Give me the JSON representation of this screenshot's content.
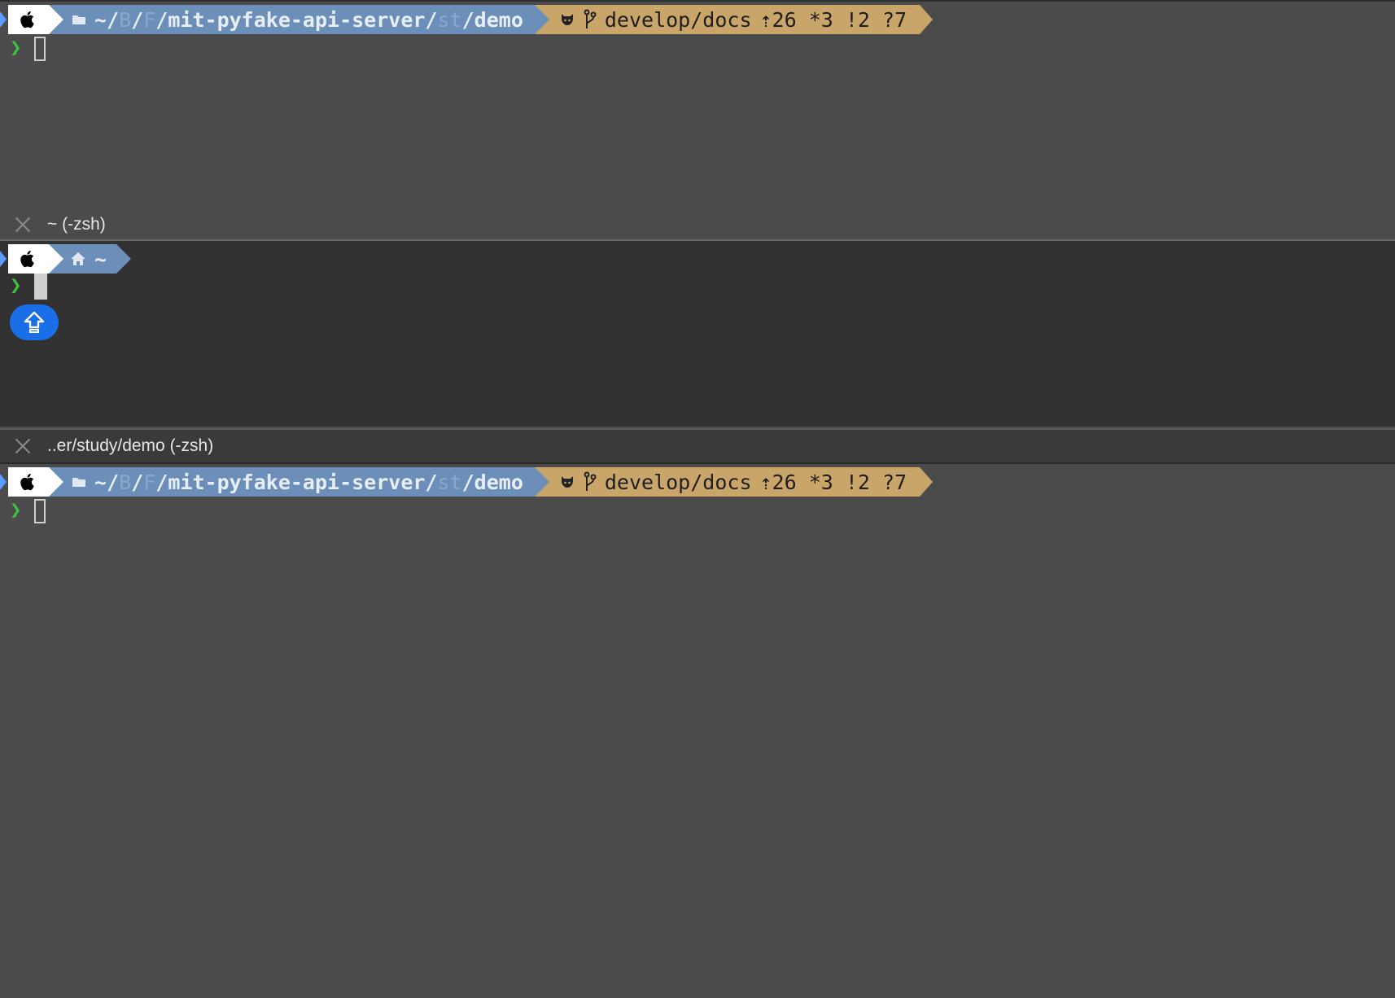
{
  "pane_top": {
    "prompt": {
      "path_home": "~/",
      "path_b": "B",
      "sep1": "/",
      "path_f": "F",
      "sep2": "/",
      "path_main": "mit-pyfake-api-server/",
      "path_st": "st",
      "path_end": "/demo",
      "git_branch": "develop/docs",
      "git_status": "⇡26 *3 !2 ?7"
    }
  },
  "divider_1": {
    "title": "~ (-zsh)"
  },
  "pane_middle": {
    "prompt": {
      "home_path": "~"
    }
  },
  "divider_2": {
    "title": "..er/study/demo (-zsh)"
  },
  "pane_bottom": {
    "prompt": {
      "path_home": "~/",
      "path_b": "B",
      "sep1": "/",
      "path_f": "F",
      "sep2": "/",
      "path_main": "mit-pyfake-api-server/",
      "path_st": "st",
      "path_end": "/demo",
      "git_branch": "develop/docs",
      "git_status": "⇡26 *3 !2 ?7"
    }
  },
  "icons": {
    "prompt_caret": "❯",
    "apple": "apple-icon",
    "folder": "folder-icon",
    "github": "github-icon",
    "branch": "git-branch-icon",
    "home": "home-icon",
    "caps_lock": "caps-lock-icon"
  },
  "colors": {
    "path_segment": "#6b8fb9",
    "git_segment": "#c9a56a",
    "caret": "#3fc03f",
    "caps_badge": "#1a6fe8"
  }
}
